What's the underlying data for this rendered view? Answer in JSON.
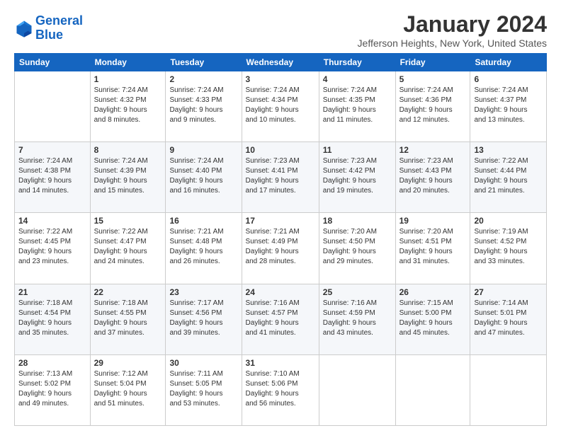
{
  "header": {
    "logo_line1": "General",
    "logo_line2": "Blue",
    "month": "January 2024",
    "location": "Jefferson Heights, New York, United States"
  },
  "weekdays": [
    "Sunday",
    "Monday",
    "Tuesday",
    "Wednesday",
    "Thursday",
    "Friday",
    "Saturday"
  ],
  "weeks": [
    [
      {
        "num": "",
        "detail": ""
      },
      {
        "num": "1",
        "detail": "Sunrise: 7:24 AM\nSunset: 4:32 PM\nDaylight: 9 hours\nand 8 minutes."
      },
      {
        "num": "2",
        "detail": "Sunrise: 7:24 AM\nSunset: 4:33 PM\nDaylight: 9 hours\nand 9 minutes."
      },
      {
        "num": "3",
        "detail": "Sunrise: 7:24 AM\nSunset: 4:34 PM\nDaylight: 9 hours\nand 10 minutes."
      },
      {
        "num": "4",
        "detail": "Sunrise: 7:24 AM\nSunset: 4:35 PM\nDaylight: 9 hours\nand 11 minutes."
      },
      {
        "num": "5",
        "detail": "Sunrise: 7:24 AM\nSunset: 4:36 PM\nDaylight: 9 hours\nand 12 minutes."
      },
      {
        "num": "6",
        "detail": "Sunrise: 7:24 AM\nSunset: 4:37 PM\nDaylight: 9 hours\nand 13 minutes."
      }
    ],
    [
      {
        "num": "7",
        "detail": "Sunrise: 7:24 AM\nSunset: 4:38 PM\nDaylight: 9 hours\nand 14 minutes."
      },
      {
        "num": "8",
        "detail": "Sunrise: 7:24 AM\nSunset: 4:39 PM\nDaylight: 9 hours\nand 15 minutes."
      },
      {
        "num": "9",
        "detail": "Sunrise: 7:24 AM\nSunset: 4:40 PM\nDaylight: 9 hours\nand 16 minutes."
      },
      {
        "num": "10",
        "detail": "Sunrise: 7:23 AM\nSunset: 4:41 PM\nDaylight: 9 hours\nand 17 minutes."
      },
      {
        "num": "11",
        "detail": "Sunrise: 7:23 AM\nSunset: 4:42 PM\nDaylight: 9 hours\nand 19 minutes."
      },
      {
        "num": "12",
        "detail": "Sunrise: 7:23 AM\nSunset: 4:43 PM\nDaylight: 9 hours\nand 20 minutes."
      },
      {
        "num": "13",
        "detail": "Sunrise: 7:22 AM\nSunset: 4:44 PM\nDaylight: 9 hours\nand 21 minutes."
      }
    ],
    [
      {
        "num": "14",
        "detail": "Sunrise: 7:22 AM\nSunset: 4:45 PM\nDaylight: 9 hours\nand 23 minutes."
      },
      {
        "num": "15",
        "detail": "Sunrise: 7:22 AM\nSunset: 4:47 PM\nDaylight: 9 hours\nand 24 minutes."
      },
      {
        "num": "16",
        "detail": "Sunrise: 7:21 AM\nSunset: 4:48 PM\nDaylight: 9 hours\nand 26 minutes."
      },
      {
        "num": "17",
        "detail": "Sunrise: 7:21 AM\nSunset: 4:49 PM\nDaylight: 9 hours\nand 28 minutes."
      },
      {
        "num": "18",
        "detail": "Sunrise: 7:20 AM\nSunset: 4:50 PM\nDaylight: 9 hours\nand 29 minutes."
      },
      {
        "num": "19",
        "detail": "Sunrise: 7:20 AM\nSunset: 4:51 PM\nDaylight: 9 hours\nand 31 minutes."
      },
      {
        "num": "20",
        "detail": "Sunrise: 7:19 AM\nSunset: 4:52 PM\nDaylight: 9 hours\nand 33 minutes."
      }
    ],
    [
      {
        "num": "21",
        "detail": "Sunrise: 7:18 AM\nSunset: 4:54 PM\nDaylight: 9 hours\nand 35 minutes."
      },
      {
        "num": "22",
        "detail": "Sunrise: 7:18 AM\nSunset: 4:55 PM\nDaylight: 9 hours\nand 37 minutes."
      },
      {
        "num": "23",
        "detail": "Sunrise: 7:17 AM\nSunset: 4:56 PM\nDaylight: 9 hours\nand 39 minutes."
      },
      {
        "num": "24",
        "detail": "Sunrise: 7:16 AM\nSunset: 4:57 PM\nDaylight: 9 hours\nand 41 minutes."
      },
      {
        "num": "25",
        "detail": "Sunrise: 7:16 AM\nSunset: 4:59 PM\nDaylight: 9 hours\nand 43 minutes."
      },
      {
        "num": "26",
        "detail": "Sunrise: 7:15 AM\nSunset: 5:00 PM\nDaylight: 9 hours\nand 45 minutes."
      },
      {
        "num": "27",
        "detail": "Sunrise: 7:14 AM\nSunset: 5:01 PM\nDaylight: 9 hours\nand 47 minutes."
      }
    ],
    [
      {
        "num": "28",
        "detail": "Sunrise: 7:13 AM\nSunset: 5:02 PM\nDaylight: 9 hours\nand 49 minutes."
      },
      {
        "num": "29",
        "detail": "Sunrise: 7:12 AM\nSunset: 5:04 PM\nDaylight: 9 hours\nand 51 minutes."
      },
      {
        "num": "30",
        "detail": "Sunrise: 7:11 AM\nSunset: 5:05 PM\nDaylight: 9 hours\nand 53 minutes."
      },
      {
        "num": "31",
        "detail": "Sunrise: 7:10 AM\nSunset: 5:06 PM\nDaylight: 9 hours\nand 56 minutes."
      },
      {
        "num": "",
        "detail": ""
      },
      {
        "num": "",
        "detail": ""
      },
      {
        "num": "",
        "detail": ""
      }
    ]
  ]
}
